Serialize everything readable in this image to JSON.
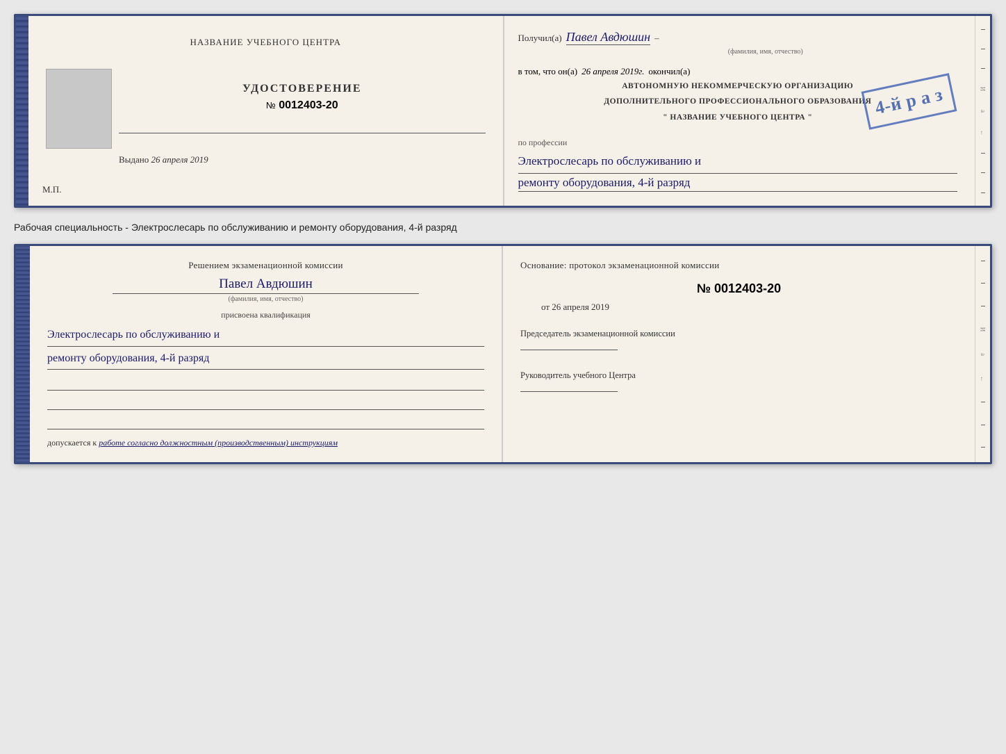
{
  "topBooklet": {
    "left": {
      "centerTitle": "НАЗВАНИЕ УЧЕБНОГО ЦЕНТРА",
      "certTitle": "УДОСТОВЕРЕНИЕ",
      "certNumberPrefix": "№",
      "certNumber": "0012403-20",
      "issuedLabel": "Выдано",
      "issuedDate": "26 апреля 2019",
      "mpLabel": "М.П."
    },
    "right": {
      "recipientLabel": "Получил(а)",
      "recipientName": "Павел Авдюшин",
      "recipientSubLabel": "(фамилия, имя, отчество)",
      "vtomLabel": "в том, что он(а)",
      "vtomDate": "26 апреля 2019г.",
      "okonchilLabel": "окончил(а)",
      "stampBigText": "4-й р а з",
      "stampLine1": "АВТОНОМНУЮ НЕКОММЕРЧЕСКУЮ ОРГАНИЗАЦИЮ",
      "stampLine2": "ДОПОЛНИТЕЛЬНОГО ПРОФЕССИОНАЛЬНОГО ОБРАЗОВАНИЯ",
      "stampLine3": "\" НАЗВАНИЕ УЧЕБНОГО ЦЕНТРА \"",
      "professionLabel": "по профессии",
      "professionLine1": "Электрослесарь по обслуживанию и",
      "professionLine2": "ремонту оборудования, 4-й разряд"
    }
  },
  "betweenText": "Рабочая специальность - Электрослесарь по обслуживанию и ремонту оборудования, 4-й разряд",
  "bottomBooklet": {
    "left": {
      "decisionTitle": "Решением экзаменационной комиссии",
      "personName": "Павел Авдюшин",
      "personSubLabel": "(фамилия, имя, отчество)",
      "assignedLabel": "присвоена квалификация",
      "qualLine1": "Электрослесарь по обслуживанию и",
      "qualLine2": "ремонту оборудования, 4-й разряд",
      "допускLabel": "допускается к",
      "допускText": "работе согласно должностным (производственным) инструкциям"
    },
    "right": {
      "osnovTitle": "Основание: протокол экзаменационной комиссии",
      "osnovNumberPrefix": "№",
      "osnovNumber": "0012403-20",
      "osnovDatePrefix": "от",
      "osnovDate": "26 апреля 2019",
      "chairLabel": "Председатель экзаменационной комиссии",
      "rukovoditelLabel": "Руководитель учебного Центра"
    }
  },
  "edgeMarks": {
    "items": [
      "И",
      "а",
      "←",
      "–",
      "–",
      "–",
      "–"
    ]
  }
}
